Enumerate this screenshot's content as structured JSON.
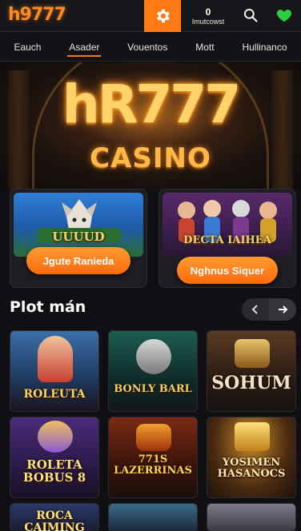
{
  "header": {
    "logo": "h9777",
    "notifications_count": "0",
    "notifications_label": "Imutcowst",
    "icons": {
      "settings": "gear-icon",
      "search": "search-icon",
      "favorites": "heart-icon"
    },
    "accent": "#ff7a12",
    "favorites_color": "#2ecc40"
  },
  "nav": {
    "items": [
      {
        "label": "Eauch"
      },
      {
        "label": "Asader",
        "active": true
      },
      {
        "label": "Vouentos"
      },
      {
        "label": "Mott"
      },
      {
        "label": "Hullinanco"
      }
    ]
  },
  "hero": {
    "title": "hR777",
    "subtitle": "CASINO"
  },
  "promos": [
    {
      "art_text": "UUUUD",
      "button_label": "Jgute Ranieda"
    },
    {
      "art_text": "DECTA IAIHEA",
      "button_label": "Nghnus Siquer"
    }
  ],
  "section": {
    "title": "Plot mán",
    "prev_icon": "chevron-left-icon",
    "next_icon": "arrow-right-icon"
  },
  "games": [
    {
      "name": "ROLEUTA"
    },
    {
      "name": "BONLY BARL"
    },
    {
      "name": "SOHUM"
    },
    {
      "name": "ROLETA BOBUS 8"
    },
    {
      "name": "771S LAZERRINAS"
    },
    {
      "name": "YOSIMEN HASANOCS"
    },
    {
      "name": "ROCA CAIMING"
    },
    {
      "name": ""
    },
    {
      "name": ""
    }
  ]
}
